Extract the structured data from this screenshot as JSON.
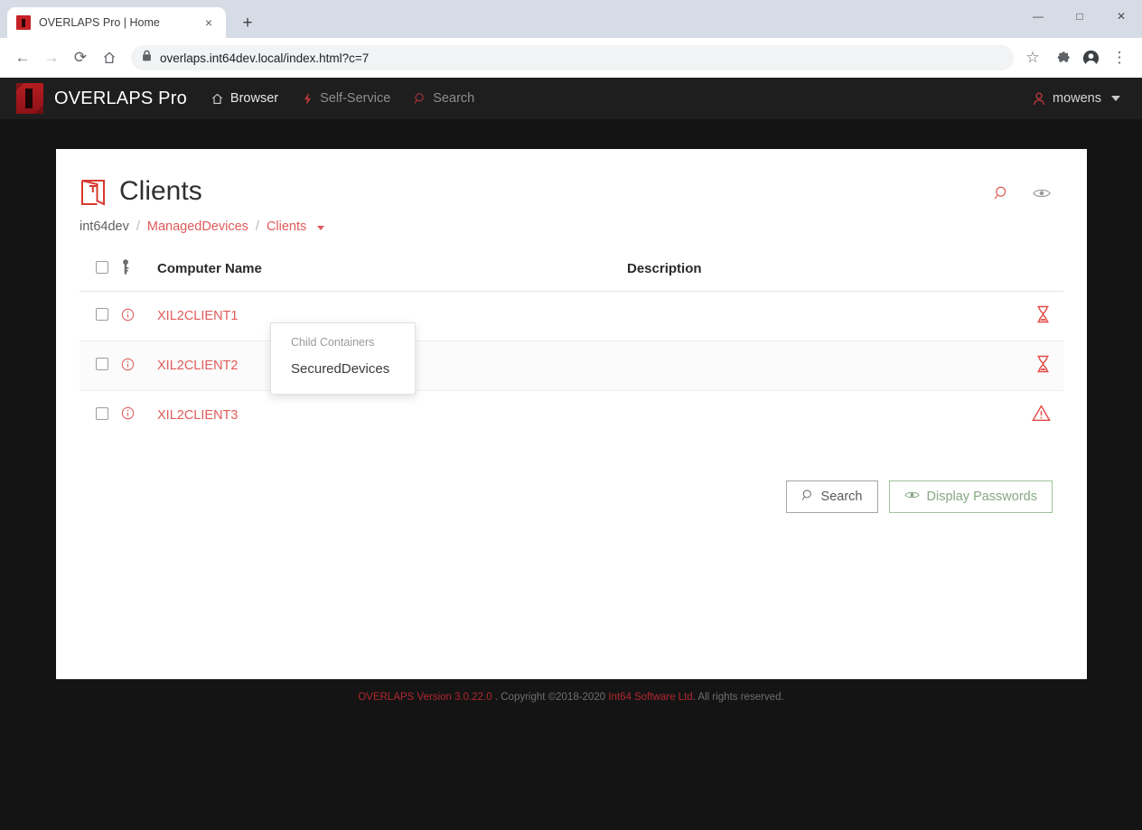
{
  "browser": {
    "tab": {
      "title": "OVERLAPS Pro | Home",
      "favicon": "overlaps-favicon",
      "close": "×"
    },
    "new_tab_label": "+",
    "window_controls": {
      "minimize": "—",
      "maximize": "□",
      "close": "✕"
    },
    "toolbar": {
      "back": "←",
      "forward": "→",
      "reload": "⟳",
      "home": "⌂",
      "star": "☆",
      "extensions": "puzzle-piece-icon",
      "profile": "profile-avatar-icon",
      "menu": "⋮"
    },
    "omnibox": {
      "url": "overlaps.int64dev.local/index.html?c=7",
      "lock": "site-information-lock"
    }
  },
  "navbar": {
    "brand": "OVERLAPS Pro",
    "links": [
      {
        "label": "Browser",
        "icon": "home-icon",
        "muted": false
      },
      {
        "label": "Self-Service",
        "icon": "bolt-icon",
        "muted": true
      },
      {
        "label": "Search",
        "icon": "search-icon",
        "muted": true
      }
    ],
    "user": {
      "name": "mowens",
      "icon": "user-icon"
    }
  },
  "page": {
    "title": "Clients",
    "icon": "open-container-icon",
    "actions": [
      {
        "name": "search-icon",
        "label": "Search"
      },
      {
        "name": "eye-icon",
        "label": "Display Passwords"
      }
    ],
    "breadcrumb": [
      {
        "label": "int64dev",
        "link": false
      },
      {
        "label": "ManagedDevices",
        "link": true
      },
      {
        "label": "Clients",
        "link": true,
        "caret": true
      }
    ],
    "separator": "/"
  },
  "dropdown": {
    "header": "Child Containers",
    "items": [
      "SecuredDevices"
    ]
  },
  "table": {
    "headers": {
      "select_all": "select-all-checkbox",
      "key": "key-icon",
      "computer_name": "Computer Name",
      "description": "Description"
    },
    "rows": [
      {
        "checked": false,
        "info": "info-icon",
        "name": "XIL2CLIENT1",
        "description": "",
        "status": "hourglass-icon"
      },
      {
        "checked": false,
        "info": "info-icon",
        "name": "XIL2CLIENT2",
        "description": "",
        "status": "hourglass-icon"
      },
      {
        "checked": false,
        "info": "info-icon",
        "name": "XIL2CLIENT3",
        "description": "",
        "status": "warning-triangle-icon"
      }
    ]
  },
  "buttons": {
    "search": {
      "label": "Search",
      "icon": "search-icon"
    },
    "display_passwords": {
      "label": "Display Passwords",
      "icon": "eye-icon"
    }
  },
  "footer": {
    "version": "OVERLAPS Version 3.0.22.0",
    "copyright": " . Copyright ©2018-2020 ",
    "company": "Int64 Software Ltd",
    "rights": ". All rights reserved."
  },
  "colors": {
    "brand_red": "#c52127",
    "link_red": "#e05a5a",
    "nav_bg": "#1e1e1e",
    "page_bg": "#141414",
    "status_red": "#e24a44",
    "green_border": "#9ec49b"
  }
}
